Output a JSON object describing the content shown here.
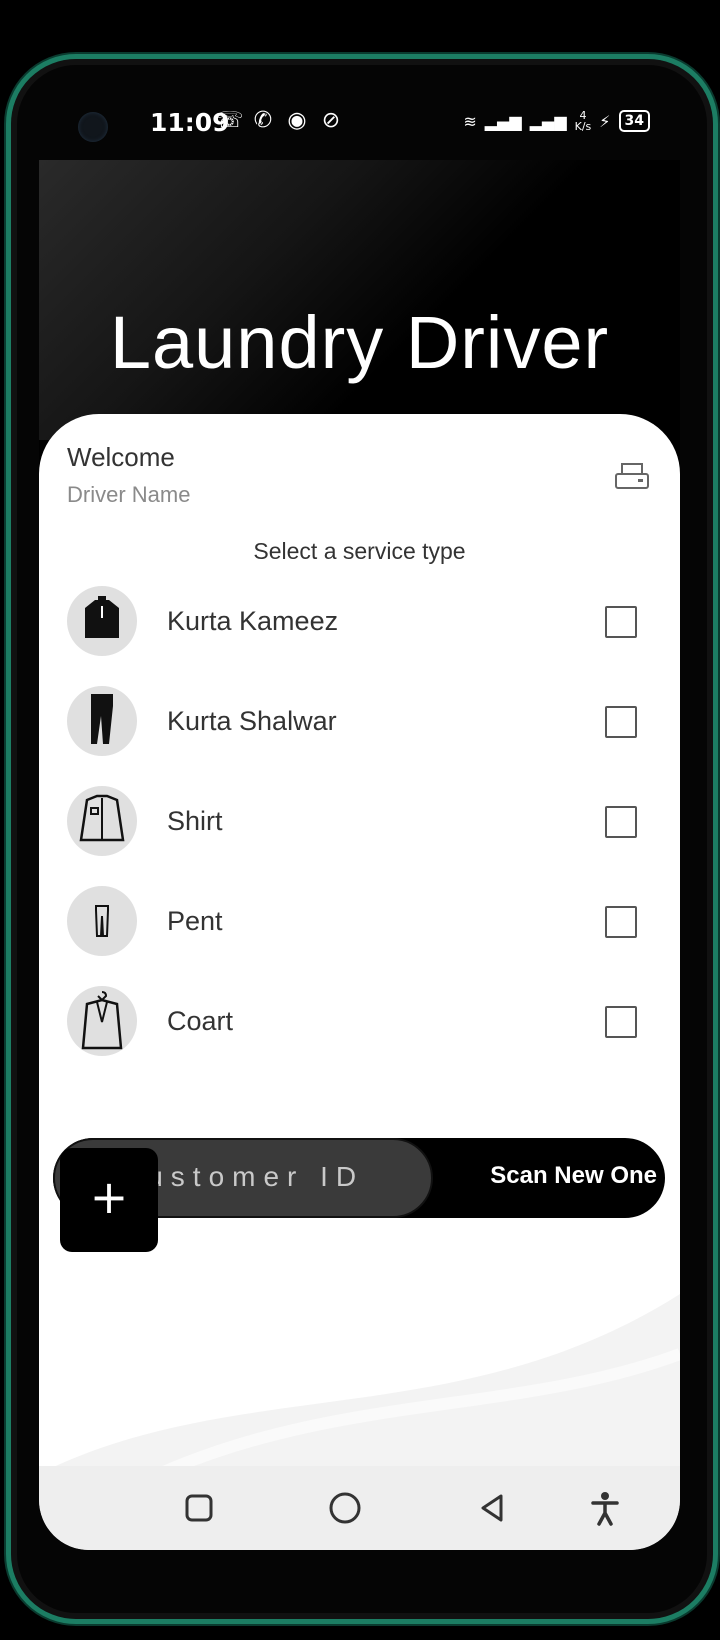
{
  "status_bar": {
    "time": "11:09",
    "battery": "34",
    "net_speed_top": "4",
    "net_speed_bottom": "K/s"
  },
  "hero": {
    "title": "Laundry Driver"
  },
  "header": {
    "welcome": "Welcome",
    "driver_name": "Driver Name"
  },
  "services": {
    "prompt": "Select a service type",
    "items": [
      {
        "label": "Kurta Kameez",
        "icon": "kurta-kameez-icon"
      },
      {
        "label": "Kurta Shalwar",
        "icon": "shalwar-icon"
      },
      {
        "label": "Shirt",
        "icon": "shirt-icon"
      },
      {
        "label": "Pent",
        "icon": "pant-icon"
      },
      {
        "label": "Coart",
        "icon": "coat-icon"
      }
    ]
  },
  "customer": {
    "placeholder": "Customer  ID",
    "scan_label": "Scan New One"
  },
  "fab": {
    "label": "+"
  },
  "colors": {
    "accent": "#000000",
    "frame": "#1c7d63",
    "card": "#ffffff"
  }
}
